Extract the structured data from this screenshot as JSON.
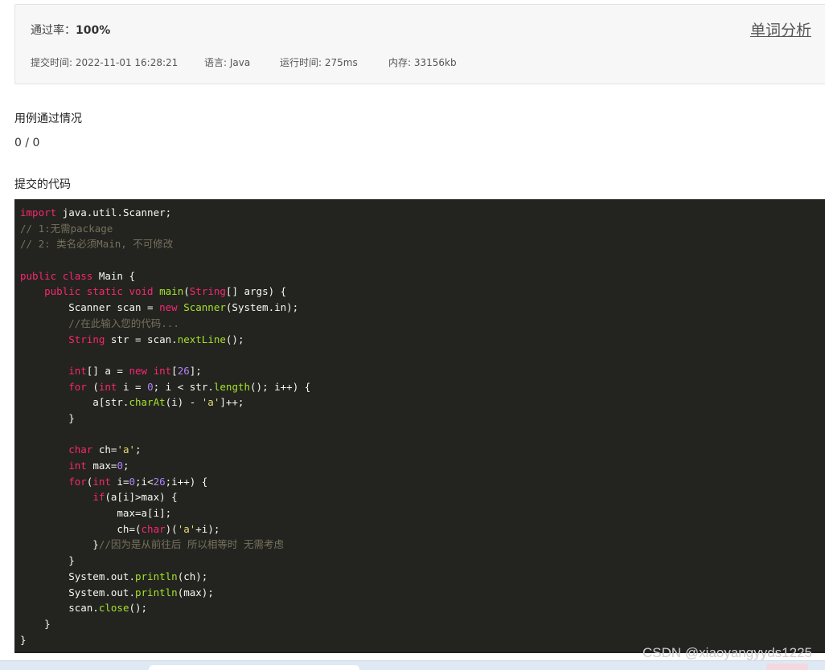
{
  "summary": {
    "pass_rate_label": "通过率：",
    "pass_rate_value": "100%",
    "analysis_link": "单词分析",
    "submit_time": "提交时间: 2022-11-01 16:28:21",
    "language": "语言: Java",
    "runtime": "运行时间: 275ms",
    "memory": "内存: 33156kb"
  },
  "cases": {
    "title": "用例通过情况",
    "count": "0 / 0"
  },
  "code_section": {
    "title": "提交的代码"
  },
  "code": [
    [
      [
        "kw",
        "import"
      ],
      [
        "p",
        " java.util.Scanner;"
      ]
    ],
    [
      [
        "cm",
        "// 1:无需package"
      ]
    ],
    [
      [
        "cm",
        "// 2: 类名必须Main, 不可修改"
      ]
    ],
    [],
    [
      [
        "kw",
        "public"
      ],
      [
        "p",
        " "
      ],
      [
        "kw",
        "class"
      ],
      [
        "p",
        " Main {"
      ]
    ],
    [
      [
        "p",
        "    "
      ],
      [
        "kw",
        "public"
      ],
      [
        "p",
        " "
      ],
      [
        "kw",
        "static"
      ],
      [
        "p",
        " "
      ],
      [
        "kw",
        "void"
      ],
      [
        "p",
        " "
      ],
      [
        "fn",
        "main"
      ],
      [
        "p",
        "("
      ],
      [
        "type",
        "String"
      ],
      [
        "p",
        "[] args) {"
      ]
    ],
    [
      [
        "p",
        "        Scanner scan = "
      ],
      [
        "kw",
        "new"
      ],
      [
        "p",
        " "
      ],
      [
        "fn",
        "Scanner"
      ],
      [
        "p",
        "(System.in);"
      ]
    ],
    [
      [
        "p",
        "        "
      ],
      [
        "cm",
        "//在此输入您的代码..."
      ]
    ],
    [
      [
        "p",
        "        "
      ],
      [
        "type",
        "String"
      ],
      [
        "p",
        " str = scan."
      ],
      [
        "fn",
        "nextLine"
      ],
      [
        "p",
        "();"
      ]
    ],
    [],
    [
      [
        "p",
        "        "
      ],
      [
        "type",
        "int"
      ],
      [
        "p",
        "[] a = "
      ],
      [
        "kw",
        "new"
      ],
      [
        "p",
        " "
      ],
      [
        "type",
        "int"
      ],
      [
        "p",
        "["
      ],
      [
        "num",
        "26"
      ],
      [
        "p",
        "];"
      ]
    ],
    [
      [
        "p",
        "        "
      ],
      [
        "kw",
        "for"
      ],
      [
        "p",
        " ("
      ],
      [
        "type",
        "int"
      ],
      [
        "p",
        " i = "
      ],
      [
        "num",
        "0"
      ],
      [
        "p",
        "; i < str."
      ],
      [
        "fn",
        "length"
      ],
      [
        "p",
        "(); i++) {"
      ]
    ],
    [
      [
        "p",
        "            a[str."
      ],
      [
        "fn",
        "charAt"
      ],
      [
        "p",
        "(i) - "
      ],
      [
        "str",
        "'a'"
      ],
      [
        "p",
        "]++;"
      ]
    ],
    [
      [
        "p",
        "        }"
      ]
    ],
    [],
    [
      [
        "p",
        "        "
      ],
      [
        "type",
        "char"
      ],
      [
        "p",
        " ch="
      ],
      [
        "str",
        "'a'"
      ],
      [
        "p",
        ";"
      ]
    ],
    [
      [
        "p",
        "        "
      ],
      [
        "type",
        "int"
      ],
      [
        "p",
        " max="
      ],
      [
        "num",
        "0"
      ],
      [
        "p",
        ";"
      ]
    ],
    [
      [
        "p",
        "        "
      ],
      [
        "kw",
        "for"
      ],
      [
        "p",
        "("
      ],
      [
        "type",
        "int"
      ],
      [
        "p",
        " i="
      ],
      [
        "num",
        "0"
      ],
      [
        "p",
        ";i<"
      ],
      [
        "num",
        "26"
      ],
      [
        "p",
        ";i++) {"
      ]
    ],
    [
      [
        "p",
        "            "
      ],
      [
        "kw",
        "if"
      ],
      [
        "p",
        "(a[i]>max) {"
      ]
    ],
    [
      [
        "p",
        "                max=a[i];"
      ]
    ],
    [
      [
        "p",
        "                ch=("
      ],
      [
        "type",
        "char"
      ],
      [
        "p",
        ")("
      ],
      [
        "str",
        "'a'"
      ],
      [
        "p",
        "+i);"
      ]
    ],
    [
      [
        "p",
        "            }"
      ],
      [
        "cm",
        "//因为是从前往后 所以相等时 无需考虑"
      ]
    ],
    [
      [
        "p",
        "        }"
      ]
    ],
    [
      [
        "p",
        "        System.out."
      ],
      [
        "fn",
        "println"
      ],
      [
        "p",
        "(ch);"
      ]
    ],
    [
      [
        "p",
        "        System.out."
      ],
      [
        "fn",
        "println"
      ],
      [
        "p",
        "(max);"
      ]
    ],
    [
      [
        "p",
        "        scan."
      ],
      [
        "fn",
        "close"
      ],
      [
        "p",
        "();"
      ]
    ],
    [
      [
        "p",
        "    }"
      ]
    ],
    [
      [
        "p",
        "}"
      ]
    ]
  ],
  "watermark": "CSDN @xiaoyangyyds1225"
}
